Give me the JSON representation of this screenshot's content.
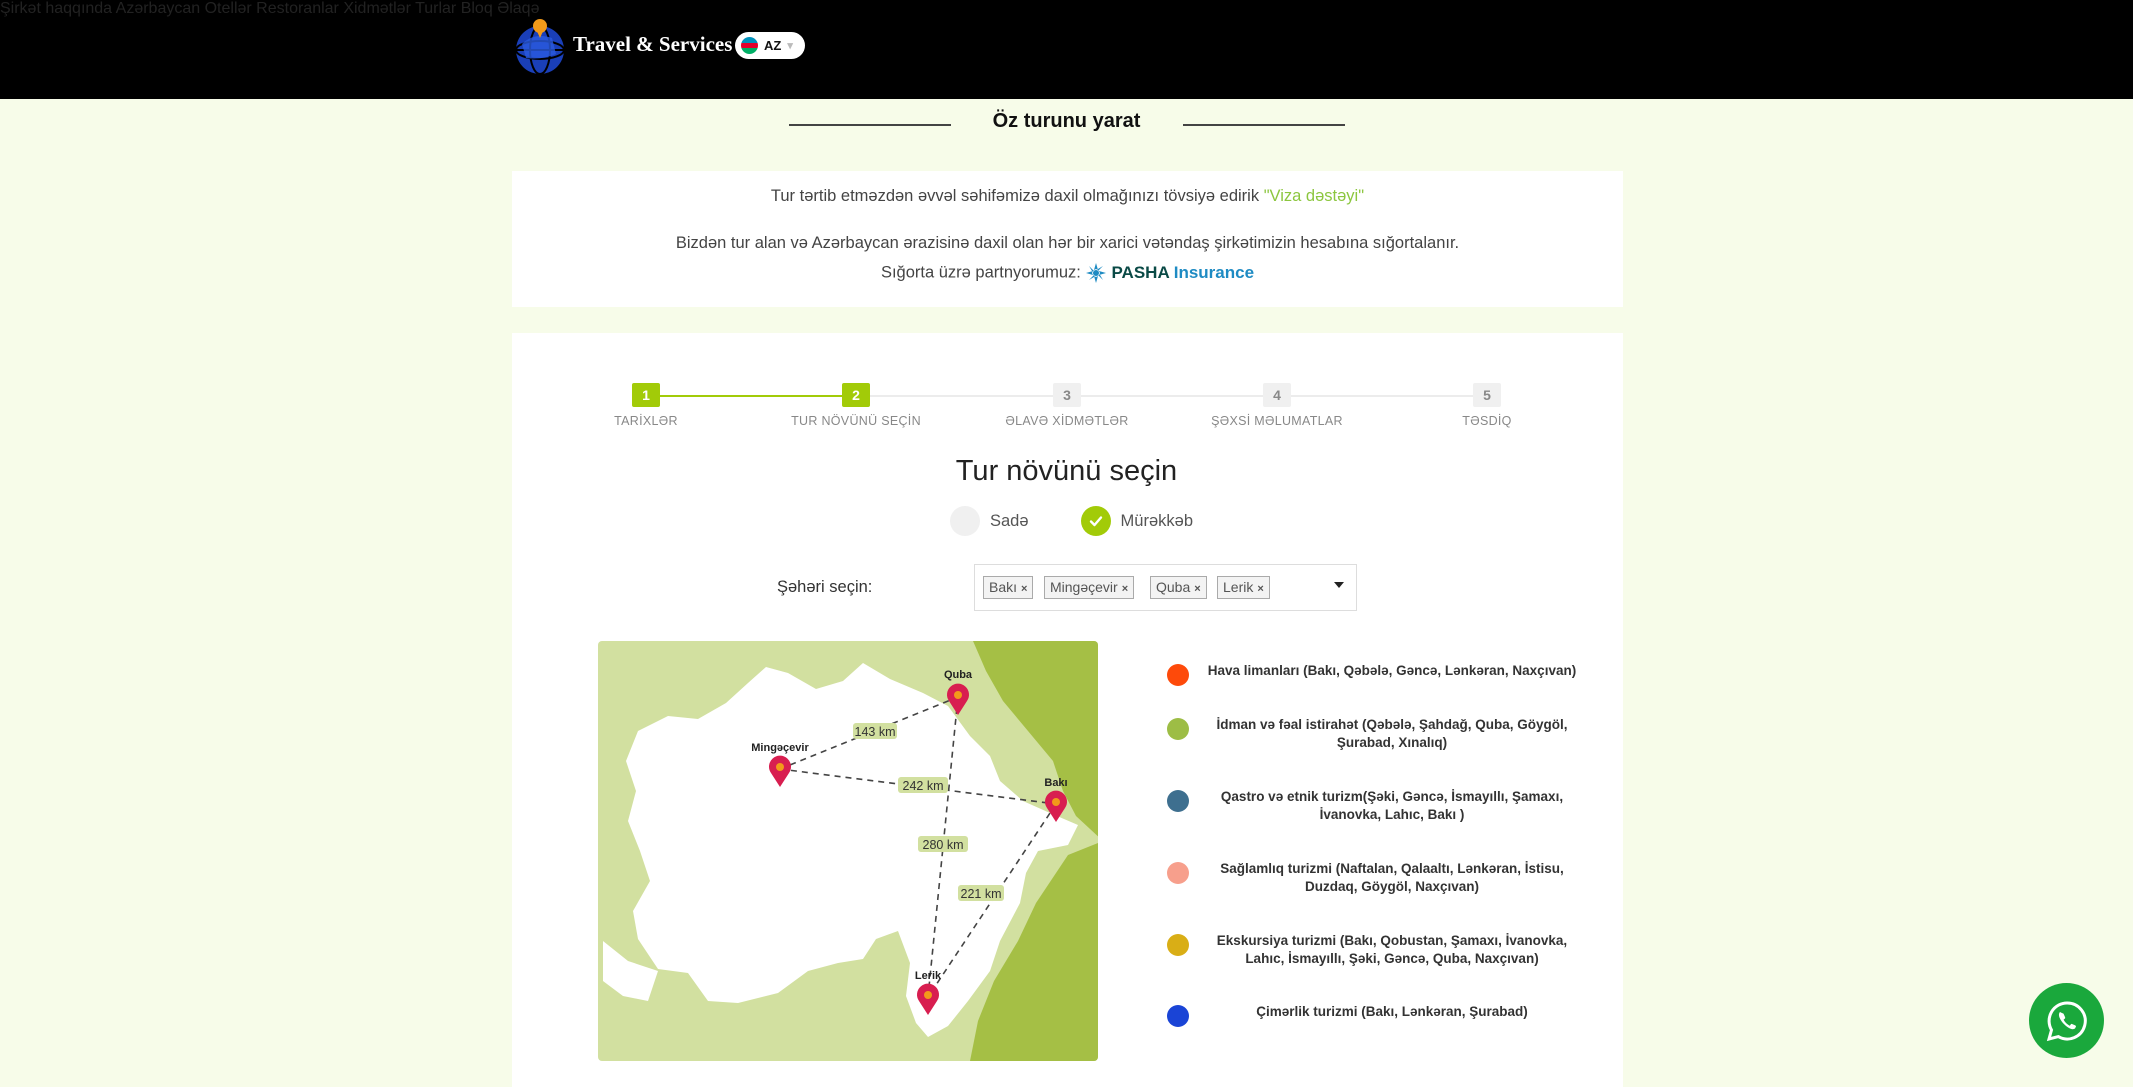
{
  "header": {
    "brand": "Travel & Services",
    "lang": "AZ",
    "nav": [
      "Şirkət haqqında",
      "Azərbaycan",
      "Otellər",
      "Restoranlar",
      "Xidmətlər",
      "Turlar",
      "Bloq",
      "Əlaqə"
    ]
  },
  "page_title": "Öz turunu yarat",
  "info": {
    "line1": "Tur tərtib etməzdən əvvəl səhifəmizə daxil olmağınızı tövsiyə edirik",
    "viza_link": "\"Viza dəstəyi\"",
    "line2": "Bizdən tur alan və Azərbaycan ərazisinə daxil olan hər bir xarici vətəndaş şirkətimizin hesabına sığortalanır.",
    "line3": "Sığorta üzrə partnyorumuz:",
    "partner_a": "PASHA",
    "partner_b": "Insurance"
  },
  "steps": [
    {
      "num": "1",
      "label": "TARİXLƏR",
      "done": true
    },
    {
      "num": "2",
      "label": "TUR NÖVÜNÜ SEÇİN",
      "done": true
    },
    {
      "num": "3",
      "label": "ƏLAVƏ XİDMƏTLƏR",
      "done": false
    },
    {
      "num": "4",
      "label": "ŞƏXSİ MƏLUMATLAR",
      "done": false
    },
    {
      "num": "5",
      "label": "TƏSDİQ",
      "done": false
    }
  ],
  "section_title": "Tur növünü seçin",
  "tour_types": {
    "simple": "Sadə",
    "complex": "Mürəkkəb",
    "selected": "complex"
  },
  "city_select": {
    "label": "Şəhəri seçin:",
    "selected": [
      "Bakı",
      "Mingəçevir",
      "Quba",
      "Lerik"
    ],
    "remove_glyph": "×"
  },
  "map": {
    "cities": [
      "Quba",
      "Mingəçevir",
      "Bakı",
      "Lerik"
    ],
    "distances": [
      "143 km",
      "242 km",
      "280 km",
      "221 km"
    ]
  },
  "legend": [
    {
      "color": "#fe4a0a",
      "text": "Hava limanları (Bakı, Qəbələ, Gəncə, Lənkəran, Naxçıvan)"
    },
    {
      "color": "#9dbd45",
      "text": "İdman və fəal istirahət (Qəbələ, Şahdağ, Quba, Göygöl, Şurabad, Xınalıq)"
    },
    {
      "color": "#3e6f8f",
      "text": "Qastro və etnik turizm(Şəki, Gəncə, İsmayıllı, Şamaxı, İvanovka, Lahıc, Bakı )"
    },
    {
      "color": "#f79f8c",
      "text": "Sağlamlıq turizmi (Naftalan, Qalaaltı, Lənkəran, İstisu, Duzdaq, Göygöl, Naxçıvan)"
    },
    {
      "color": "#d9ae16",
      "text": "Ekskursiya turizmi (Bakı, Qobustan, Şamaxı, İvanovka, Lahıc, İsmayıllı, Şəki, Gəncə, Quba, Naxçıvan)"
    },
    {
      "color": "#1a44d6",
      "text": "Çimərlik turizmi (Bakı, Lənkəran, Şurabad)"
    }
  ],
  "colors": {
    "accent": "#a2cb08",
    "header_bg": "#000000",
    "page_bg": "#f7fce9",
    "whatsapp": "#1aa83c"
  }
}
